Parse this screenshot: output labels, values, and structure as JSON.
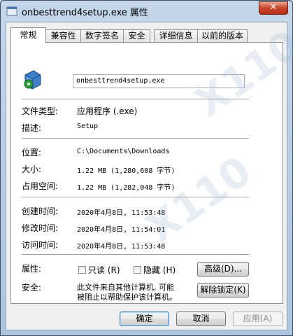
{
  "window": {
    "title": "onbesttrend4setup.exe 属性",
    "close_label": "✕"
  },
  "tabs": [
    {
      "label": "常规"
    },
    {
      "label": "兼容性"
    },
    {
      "label": "数字签名"
    },
    {
      "label": "安全"
    },
    {
      "label": "详细信息"
    },
    {
      "label": "以前的版本"
    }
  ],
  "general": {
    "filename": "onbesttrend4setup.exe",
    "rows": {
      "type_label": "文件类型:",
      "type_value": "应用程序 (.exe)",
      "desc_label": "描述:",
      "desc_value": "Setup",
      "location_label": "位置:",
      "location_value": "C:\\Documents\\Downloads",
      "size_label": "大小:",
      "size_value": "1.22 MB (1,280,608 字节)",
      "disk_label": "占用空间:",
      "disk_value": "1.22 MB (1,282,048 字节)",
      "created_label": "创建时间:",
      "created_value": "2020年4月8日, 11:53:48",
      "modified_label": "修改时间:",
      "modified_value": "2020年4月8日, 11:54:01",
      "accessed_label": "访问时间:",
      "accessed_value": "2020年4月8日, 11:53:48"
    },
    "attributes": {
      "label": "属性:",
      "readonly_label": "只读 (R)",
      "hidden_label": "隐藏 (H)",
      "advanced_label": "高级(D)..."
    },
    "security": {
      "label": "安全:",
      "text_line1": "此文件来自其他计算机, 可能",
      "text_line2": "被阻止以帮助保护该计算机。",
      "unblock_label": "解除锁定(K)"
    }
  },
  "footer": {
    "ok": "确定",
    "cancel": "取消",
    "apply": "应用(A)"
  }
}
